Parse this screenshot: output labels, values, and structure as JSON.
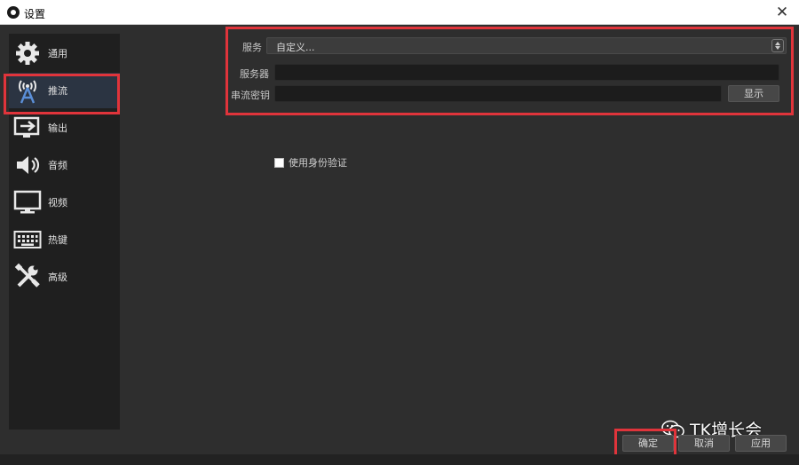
{
  "window": {
    "title": "设置",
    "close_glyph": "✕"
  },
  "sidebar": {
    "items": [
      {
        "label": "通用",
        "icon": "gear-icon"
      },
      {
        "label": "推流",
        "icon": "broadcast-tower-icon",
        "active": true
      },
      {
        "label": "输出",
        "icon": "output-arrow-icon"
      },
      {
        "label": "音频",
        "icon": "speaker-icon"
      },
      {
        "label": "视频",
        "icon": "monitor-icon"
      },
      {
        "label": "热键",
        "icon": "keyboard-icon"
      },
      {
        "label": "高级",
        "icon": "wrench-screwdriver-icon"
      }
    ]
  },
  "stream": {
    "service_label": "服务",
    "service_value": "自定义...",
    "server_label": "服务器",
    "server_value": "",
    "key_label": "串流密钥",
    "key_value": "",
    "show_button": "显示",
    "auth_checkbox": "使用身份验证",
    "auth_checked": false
  },
  "footer": {
    "ok": "确定",
    "cancel": "取消",
    "apply": "应用"
  },
  "watermark": {
    "text": "TK增长会",
    "icon": "wechat-icon"
  },
  "colors": {
    "highlight": "#e0343b",
    "background": "#2e2e2e",
    "sidebar": "#1f1f1f"
  }
}
